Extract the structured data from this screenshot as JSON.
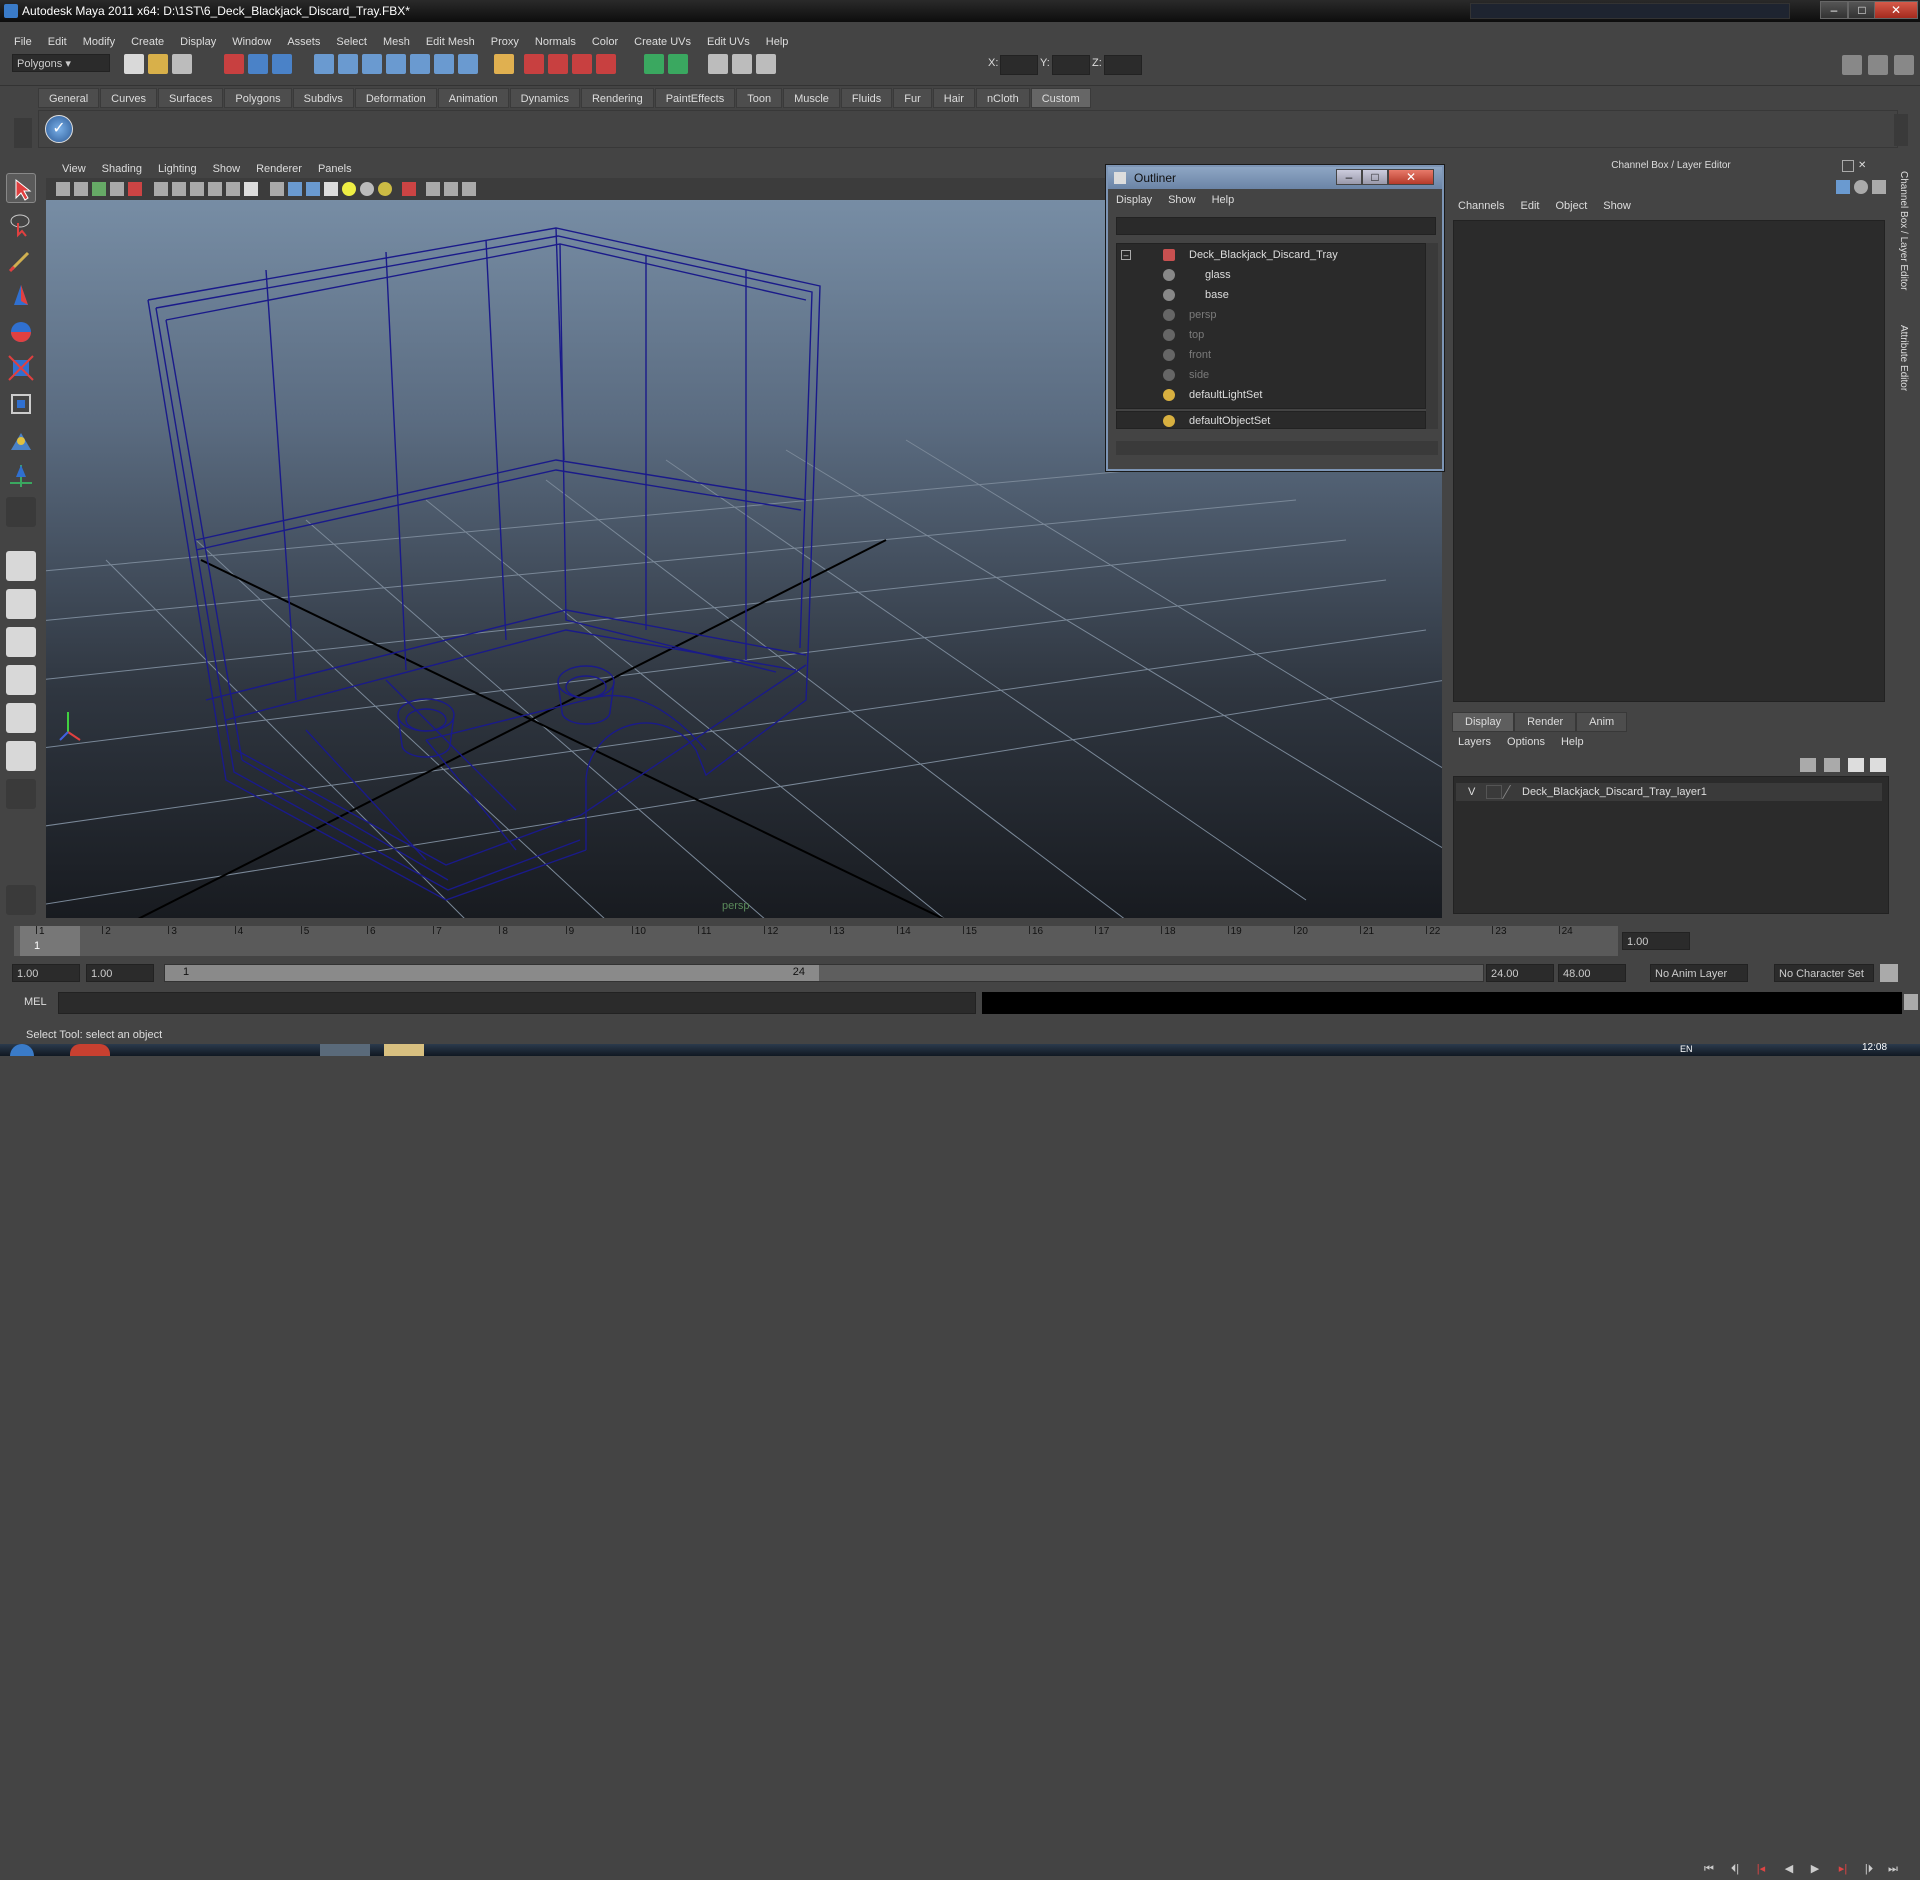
{
  "window": {
    "title": "Autodesk Maya 2011 x64: D:\\1ST\\6_Deck_Blackjack_Discard_Tray.FBX*"
  },
  "menubar": [
    "File",
    "Edit",
    "Modify",
    "Create",
    "Display",
    "Window",
    "Assets",
    "Select",
    "Mesh",
    "Edit Mesh",
    "Proxy",
    "Normals",
    "Color",
    "Create UVs",
    "Edit UVs",
    "Help"
  ],
  "statusline": {
    "mode": "Polygons",
    "x_label": "X:",
    "y_label": "Y:",
    "z_label": "Z:"
  },
  "shelf": {
    "tabs": [
      "General",
      "Curves",
      "Surfaces",
      "Polygons",
      "Subdivs",
      "Deformation",
      "Animation",
      "Dynamics",
      "Rendering",
      "PaintEffects",
      "Toon",
      "Muscle",
      "Fluids",
      "Fur",
      "Hair",
      "nCloth",
      "Custom"
    ],
    "active": "Custom"
  },
  "viewport": {
    "menu": [
      "View",
      "Shading",
      "Lighting",
      "Show",
      "Renderer",
      "Panels"
    ],
    "camera": "persp"
  },
  "outliner": {
    "title": "Outliner",
    "menu": [
      "Display",
      "Show",
      "Help"
    ],
    "items": [
      {
        "label": "Deck_Blackjack_Discard_Tray",
        "dim": false
      },
      {
        "label": "glass",
        "dim": false
      },
      {
        "label": "base",
        "dim": false
      },
      {
        "label": "persp",
        "dim": true
      },
      {
        "label": "top",
        "dim": true
      },
      {
        "label": "front",
        "dim": true
      },
      {
        "label": "side",
        "dim": true
      },
      {
        "label": "defaultLightSet",
        "dim": false
      },
      {
        "label": "defaultObjectSet",
        "dim": false
      }
    ]
  },
  "channel_box": {
    "title": "Channel Box / Layer Editor",
    "menu": [
      "Channels",
      "Edit",
      "Object",
      "Show"
    ]
  },
  "side_tabs": [
    "Channel Box / Layer Editor",
    "Attribute Editor"
  ],
  "layer_editor": {
    "tabs": [
      "Display",
      "Render",
      "Anim"
    ],
    "active": "Display",
    "menu": [
      "Layers",
      "Options",
      "Help"
    ],
    "layer": {
      "visible": "V",
      "name": "Deck_Blackjack_Discard_Tray_layer1"
    }
  },
  "time_slider": {
    "ticks": [
      "1",
      "2",
      "3",
      "4",
      "5",
      "6",
      "7",
      "8",
      "9",
      "10",
      "11",
      "12",
      "13",
      "14",
      "15",
      "16",
      "17",
      "18",
      "19",
      "20",
      "21",
      "22",
      "23",
      "24"
    ],
    "current": "1",
    "current_field": "1.00"
  },
  "range": {
    "start": "1.00",
    "start2": "1.00",
    "slider_start": "1",
    "slider_end": "24",
    "end": "24.00",
    "end2": "48.00",
    "anim_layer": "No Anim Layer",
    "char_set": "No Character Set"
  },
  "cmd": {
    "label": "MEL"
  },
  "help_line": "Select Tool: select an object",
  "taskbar": {
    "lang": "EN",
    "time": "12:08"
  }
}
